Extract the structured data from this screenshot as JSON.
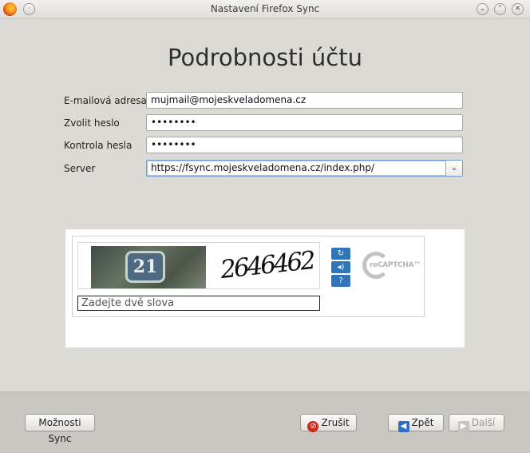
{
  "window": {
    "title": "Nastavení Firefox Sync",
    "minimize_glyph": "⌄",
    "maximize_glyph": "⌃",
    "close_glyph": "✕",
    "menu_glyph": "·"
  },
  "page": {
    "heading": "Podrobnosti účtu"
  },
  "form": {
    "email": {
      "label": "E-mailová adresa",
      "value": "mujmail@mojeskveladomena.cz"
    },
    "password": {
      "label": "Zvolit heslo",
      "value": "••••••••"
    },
    "confirm": {
      "label": "Kontrola hesla",
      "value": "••••••••"
    },
    "server": {
      "label": "Server",
      "value": "https://fsync.mojeskveladomena.cz/index.php/",
      "dropdown_glyph": "⌄"
    }
  },
  "captcha": {
    "photo_text": "21",
    "scribble_text": "2646462",
    "input_placeholder": "Zadejte dvě slova",
    "reload_glyph": "↻",
    "audio_glyph": "◂)",
    "help_glyph": "?",
    "logo_text": "reCAPTCHA™",
    "icons": [
      "reload-icon",
      "audio-icon",
      "help-icon",
      "recaptcha-logo"
    ]
  },
  "footer": {
    "options_label": "Možnosti Sync",
    "cancel_label": "Zrušit",
    "back_label": "Zpět",
    "next_label": "Další"
  },
  "colors": {
    "captcha_button": "#2f75b7",
    "cancel_icon": "#d0271d",
    "back_icon": "#2c6fc4"
  }
}
